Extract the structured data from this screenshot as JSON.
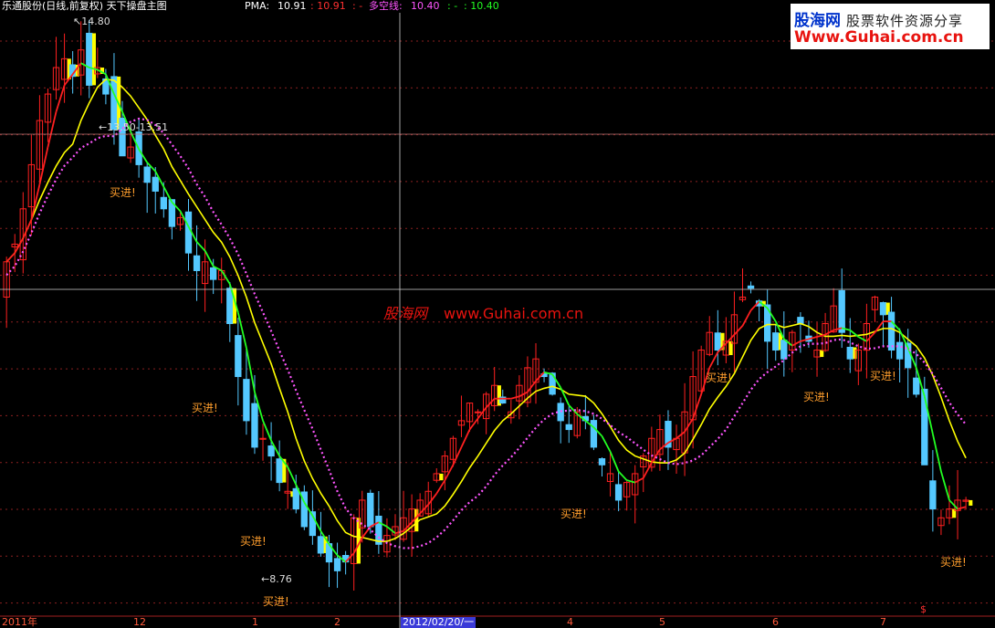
{
  "header": {
    "title": "乐通股份(日线,前复权) 天下操盘主图",
    "pma_label": "PMA:",
    "pma_value": "10.91",
    "v2": ": 10.91",
    "sep1": ": -",
    "duo_label": "多空线:",
    "duo_value": "10.40",
    "sep2": ": -",
    "v4": ": 10.40"
  },
  "watermark": {
    "brand_cn": "股海网",
    "brand_tag": "股票软件资源分享",
    "url": "Www.Guhai.com.cn",
    "center_cn": "股海网",
    "center_url": "www.Guhai.com.cn"
  },
  "annotations": {
    "high": "14.80",
    "mid": "13.50-13.51",
    "low": "←8.76"
  },
  "buy_signals": [
    "买进!",
    "买进!",
    "买进!",
    "买进!",
    "买进!",
    "买进!",
    "买进!",
    "买进!",
    "买进!"
  ],
  "x_labels": [
    "2011年",
    "12",
    "1",
    "2",
    "2012/02/20/一",
    "4",
    "5",
    "6",
    "7"
  ],
  "x_marker": "$",
  "colors": {
    "up": "#ff2020",
    "down": "#54c8ff",
    "yellow_bar": "#ffff00",
    "pma": "#ffff00",
    "trend_up": "#ff2020",
    "trend_down": "#22ff22",
    "dotted": "#ff55ff",
    "grid": "#8a2020",
    "crosshair": "#cfcfcf"
  },
  "chart_data": {
    "type": "candlestick",
    "price_range": [
      8.4,
      15.1
    ],
    "markers": {
      "high": 14.8,
      "low": 8.76,
      "level": 13.5
    },
    "closes": [
      12.3,
      12.5,
      12.9,
      13.4,
      13.9,
      14.2,
      14.5,
      14.6,
      14.4,
      14.7,
      14.3,
      14.5,
      14.2,
      13.8,
      13.5,
      13.6,
      13.4,
      13.2,
      13.1,
      12.9,
      12.7,
      12.8,
      12.4,
      12.2,
      12.3,
      12.1,
      12.2,
      11.6,
      11.0,
      10.5,
      10.2,
      10.3,
      10.1,
      9.8,
      9.7,
      9.5,
      9.3,
      9.2,
      9.0,
      8.9,
      8.8,
      8.9,
      9.4,
      9.6,
      9.3,
      9.1,
      9.2,
      9.3,
      9.4,
      9.5,
      9.6,
      9.7,
      9.9,
      10.1,
      10.3,
      10.5,
      10.7,
      10.6,
      10.8,
      10.9,
      10.7,
      10.6,
      10.9,
      11.1,
      11.2,
      11.0,
      10.8,
      10.5,
      10.4,
      10.6,
      10.5,
      10.2,
      10.0,
      9.9,
      9.6,
      9.8,
      9.9,
      10.1,
      10.3,
      10.4,
      10.2,
      10.3,
      10.6,
      11.0,
      11.3,
      11.5,
      11.3,
      11.4,
      11.7,
      11.9,
      12.0,
      11.8,
      11.4,
      11.3,
      11.2,
      11.5,
      11.6,
      11.4,
      11.3,
      11.6,
      11.8,
      11.5,
      11.2,
      11.3,
      11.6,
      11.9,
      11.7,
      11.3,
      11.2,
      11.1,
      10.8,
      10.0,
      9.5,
      9.4,
      9.5,
      9.6,
      9.6
    ],
    "series": [
      {
        "name": "PMA",
        "values": []
      },
      {
        "name": "多空线",
        "values": []
      }
    ]
  }
}
